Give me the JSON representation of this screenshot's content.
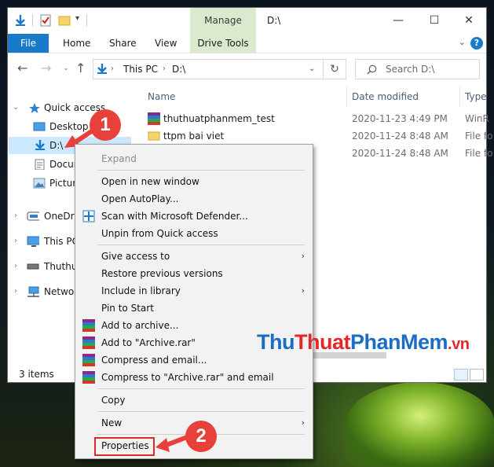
{
  "window": {
    "title": "D:\\",
    "controls": {
      "minimize": "—",
      "maximize": "☐",
      "close": "✕"
    }
  },
  "ribbon": {
    "manage_label": "Manage",
    "tabs": [
      "File",
      "Home",
      "Share",
      "View"
    ],
    "drive_tools_label": "Drive Tools"
  },
  "address": {
    "crumbs": [
      "This PC",
      "D:\\"
    ],
    "search_placeholder": "Search D:\\"
  },
  "nav_pane": {
    "quick_access": "Quick access",
    "items": [
      "Desktop",
      "D:\\",
      "Docum",
      "Pictur"
    ],
    "onedrive": "OneDriv",
    "this_pc": "This PC",
    "thuthu": "Thuthu",
    "network": "Netwo"
  },
  "columns": {
    "name": "Name",
    "date": "Date modified",
    "type": "Type"
  },
  "files": [
    {
      "name": "thuthuatphanmem_test",
      "date": "2020-11-23 4:49 PM",
      "type": "WinR",
      "icon": "winrar-icon"
    },
    {
      "name": "ttpm bai viet",
      "date": "2020-11-24 8:48 AM",
      "type": "File fo",
      "icon": "folder-icon"
    },
    {
      "name": "",
      "date": "2020-11-24 8:48 AM",
      "type": "File fo",
      "icon": "folder-icon"
    }
  ],
  "status": {
    "items": "3 items"
  },
  "context_menu": {
    "expand": "Expand",
    "open_new_window": "Open in new window",
    "open_autoplay": "Open AutoPlay...",
    "scan_defender": "Scan with Microsoft Defender...",
    "unpin": "Unpin from Quick access",
    "give_access": "Give access to",
    "restore_prev": "Restore previous versions",
    "include_library": "Include in library",
    "pin_start": "Pin to Start",
    "add_archive": "Add to archive...",
    "add_archive_rar": "Add to \"Archive.rar\"",
    "compress_email": "Compress and email...",
    "compress_rar_email": "Compress to \"Archive.rar\" and email",
    "copy": "Copy",
    "new": "New",
    "properties": "Properties"
  },
  "annotations": {
    "step1": "1",
    "step2": "2"
  },
  "watermark": {
    "part1": "Thu",
    "part2": "Thuat",
    "part3": "PhanMem",
    "part4": ".vn"
  },
  "colors": {
    "accent": "#1979ca",
    "manage_tab": "#dbeacf",
    "badge": "#e8403a",
    "selection": "#cce8ff"
  }
}
